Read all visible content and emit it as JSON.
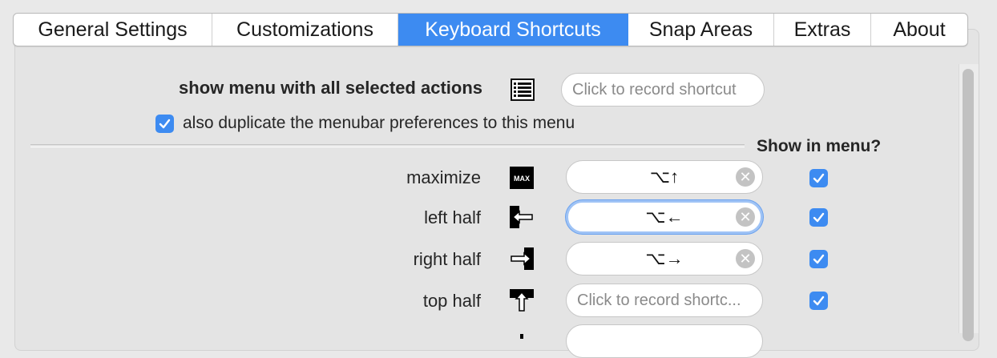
{
  "tabs": [
    {
      "label": "General Settings",
      "active": false
    },
    {
      "label": "Customizations",
      "active": false
    },
    {
      "label": "Keyboard Shortcuts",
      "active": true
    },
    {
      "label": "Snap Areas",
      "active": false
    },
    {
      "label": "Extras",
      "active": false
    },
    {
      "label": "About",
      "active": false
    }
  ],
  "menu_section": {
    "label": "show menu with all selected actions",
    "icon": "list-menu-icon",
    "shortcut_placeholder": "Click to record shortcut",
    "duplicate_label": "also duplicate the menubar preferences to this menu",
    "duplicate_checked": true
  },
  "column_header": "Show in menu?",
  "actions": [
    {
      "label": "maximize",
      "icon": "max-icon",
      "icon_text": "MAX",
      "shortcut": "⌥↑",
      "show_in_menu": true
    },
    {
      "label": "left half",
      "icon": "left-half-icon",
      "shortcut": "⌥←",
      "show_in_menu": true,
      "focused": true
    },
    {
      "label": "right half",
      "icon": "right-half-icon",
      "shortcut": "⌥→",
      "show_in_menu": true
    },
    {
      "label": "top half",
      "icon": "top-half-icon",
      "shortcut_placeholder": "Click to record shortc...",
      "show_in_menu": true
    }
  ],
  "clear_glyph": "✕",
  "colors": {
    "accent": "#3d8bf1",
    "focus_ring": "#9fc3f5"
  }
}
